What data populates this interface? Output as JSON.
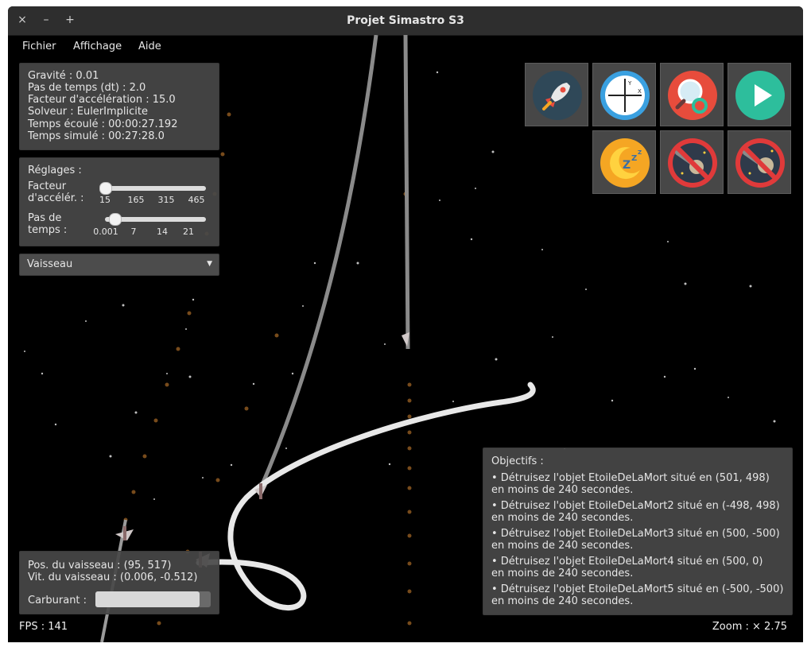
{
  "window": {
    "title": "Projet Simastro S3",
    "close": "×",
    "minimize": "–",
    "maximize": "+"
  },
  "menu": {
    "file": "Fichier",
    "view": "Affichage",
    "help": "Aide"
  },
  "info": {
    "gravity": "Gravité : 0.01",
    "timestep": "Pas de temps (dt) : 2.0",
    "acceleration": "Facteur d'accélération : 15.0",
    "solver": "Solveur : EulerImplicite",
    "elapsed": "Temps écoulé : 00:00:27.192",
    "simulated": "Temps simulé : 00:27:28.0"
  },
  "settings": {
    "title": "Réglages :",
    "accel_label_1": "Facteur",
    "accel_label_2": "d'accélér. :",
    "accel_ticks": [
      "15",
      "165",
      "315",
      "465"
    ],
    "accel_value": 15,
    "accel_range": [
      15,
      465
    ],
    "dt_label_1": "Pas de",
    "dt_label_2": "temps :",
    "dt_ticks": [
      "0.001",
      "7",
      "14",
      "21"
    ],
    "dt_value": 2,
    "dt_range": [
      0.001,
      21
    ]
  },
  "selector": {
    "value": "Vaisseau",
    "arrow": "▼"
  },
  "tools": [
    {
      "name": "rocket-icon"
    },
    {
      "name": "axes-icon"
    },
    {
      "name": "zoom-search-icon"
    },
    {
      "name": "play-icon"
    },
    {
      "name": "sleep-icon"
    },
    {
      "name": "no-asteroid-icon"
    },
    {
      "name": "no-asteroid-alt-icon"
    }
  ],
  "ship": {
    "position": "Pos. du vaisseau : (95, 517)",
    "velocity": "Vit. du vaisseau : (0.006, -0.512)",
    "fuel_label": "Carburant :",
    "fuel_level": 0.9
  },
  "objectives": {
    "title": "Objectifs :",
    "items": [
      {
        "line1": "• Détruisez l'objet EtoileDeLaMort situé en (501, 498)",
        "line2": "en moins de 240 secondes."
      },
      {
        "line1": "• Détruisez l'objet EtoileDeLaMort2 situé en (-498, 498)",
        "line2": "en moins de 240 secondes."
      },
      {
        "line1": "• Détruisez l'objet EtoileDeLaMort3 situé en (500, -500)",
        "line2": "en moins de 240 secondes."
      },
      {
        "line1": "• Détruisez l'objet EtoileDeLaMort4 situé en (500, 0)",
        "line2": "en moins de 240 secondes."
      },
      {
        "line1": "• Détruisez l'objet EtoileDeLaMort5 situé en (-500, -500)",
        "line2": "en moins de 240 secondes."
      }
    ]
  },
  "status": {
    "fps": "FPS : 141",
    "zoom": "Zoom : × 2.75"
  },
  "colors": {
    "accent_teal": "#2dbe9c",
    "rocket_bg": "#2f4858",
    "axis_blue": "#3aa0e0",
    "zoom_red": "#e74c3c",
    "moon_orange": "#f5a623",
    "forbid_red": "#e03a3a"
  }
}
